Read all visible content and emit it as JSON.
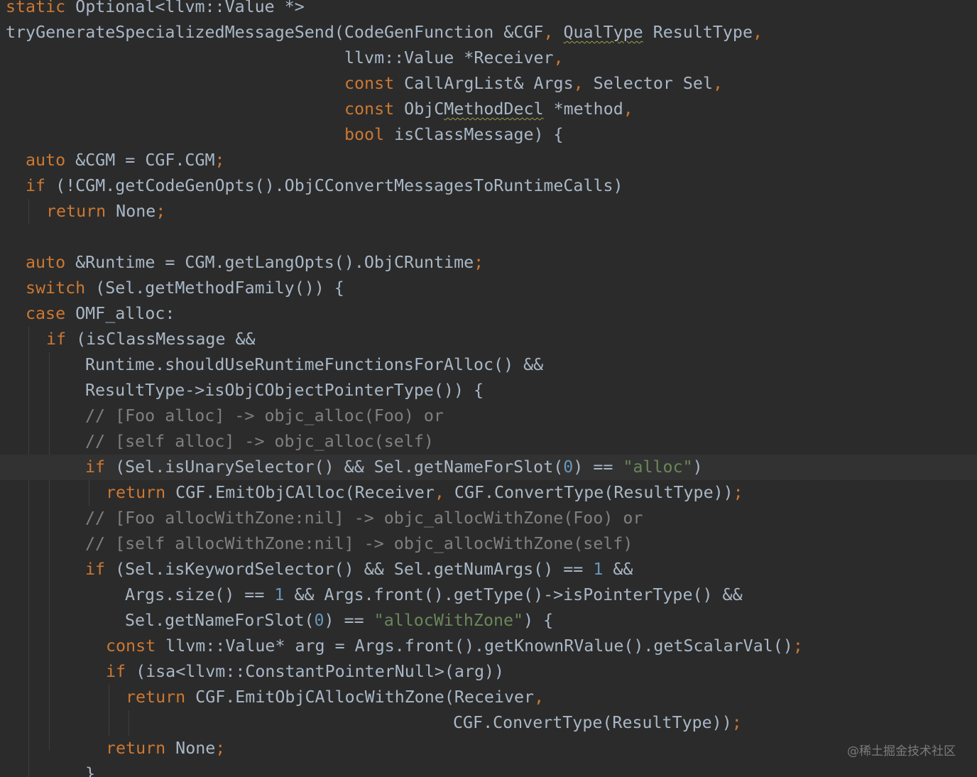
{
  "editor": {
    "lines": [
      {
        "id": 1,
        "tokens": [
          {
            "t": "static",
            "cls": "k"
          },
          {
            "t": " Optional<llvm::Value *>"
          }
        ]
      },
      {
        "id": 2,
        "tokens": [
          {
            "t": "tryGenerateSpecializedMessageSend(CodeGenFunction &CGF"
          },
          {
            "t": ",",
            "cls": "p"
          },
          {
            "t": " "
          },
          {
            "t": "QualType",
            "cls": "wavy"
          },
          {
            "t": " ResultType"
          },
          {
            "t": ",",
            "cls": "p"
          }
        ]
      },
      {
        "id": 3,
        "tokens": [
          {
            "t": "llvm::Value *Receiver"
          },
          {
            "t": ",",
            "cls": "p"
          }
        ]
      },
      {
        "id": 4,
        "tokens": [
          {
            "t": "const",
            "cls": "k"
          },
          {
            "t": " CallArgList& Args"
          },
          {
            "t": ",",
            "cls": "p"
          },
          {
            "t": " Selector Sel"
          },
          {
            "t": ",",
            "cls": "p"
          }
        ]
      },
      {
        "id": 5,
        "tokens": [
          {
            "t": "const",
            "cls": "k"
          },
          {
            "t": " ObjC"
          },
          {
            "t": "MethodDecl",
            "cls": "wavy"
          },
          {
            "t": " *method"
          },
          {
            "t": ",",
            "cls": "p"
          }
        ]
      },
      {
        "id": 6,
        "tokens": [
          {
            "t": "bool",
            "cls": "k"
          },
          {
            "t": " isClassMessage) {"
          }
        ]
      },
      {
        "id": 7,
        "tokens": [
          {
            "t": "auto",
            "cls": "k"
          },
          {
            "t": " &CGM = CGF.CGM"
          },
          {
            "t": ";",
            "cls": "p"
          }
        ]
      },
      {
        "id": 8,
        "tokens": [
          {
            "t": "if",
            "cls": "k"
          },
          {
            "t": " (!CGM.getCodeGenOpts().ObjCConvertMessagesToRuntimeCalls)"
          }
        ]
      },
      {
        "id": 9,
        "tokens": [
          {
            "t": "return",
            "cls": "k"
          },
          {
            "t": " None"
          },
          {
            "t": ";",
            "cls": "p"
          }
        ]
      },
      {
        "id": 10,
        "tokens": [
          {
            "t": "auto",
            "cls": "k"
          },
          {
            "t": " &Runtime = CGM.getLangOpts().ObjCRuntime"
          },
          {
            "t": ";",
            "cls": "p"
          }
        ]
      },
      {
        "id": 11,
        "tokens": [
          {
            "t": "switch",
            "cls": "k"
          },
          {
            "t": " (Sel.getMethodFamily()) {"
          }
        ]
      },
      {
        "id": 12,
        "tokens": [
          {
            "t": "case",
            "cls": "k"
          },
          {
            "t": " OMF_alloc:"
          }
        ]
      },
      {
        "id": 13,
        "tokens": [
          {
            "t": "if",
            "cls": "k"
          },
          {
            "t": " (isClassMessage &&"
          }
        ]
      },
      {
        "id": 14,
        "tokens": [
          {
            "t": "Runtime.shouldUseRuntimeFunctionsForAlloc() &&"
          }
        ]
      },
      {
        "id": 15,
        "tokens": [
          {
            "t": "ResultType->isObjCObjectPointerType()) {"
          }
        ]
      },
      {
        "id": 16,
        "tokens": [
          {
            "t": "// [Foo alloc] -> objc_alloc(Foo) or",
            "cls": "c"
          }
        ]
      },
      {
        "id": 17,
        "tokens": [
          {
            "t": "// [self alloc] -> objc_alloc(self)",
            "cls": "c"
          }
        ]
      },
      {
        "id": 18,
        "tokens": [
          {
            "t": "if",
            "cls": "k"
          },
          {
            "t": " (Sel.isUnarySelector() && Sel.getNameForSlot("
          },
          {
            "t": "0",
            "cls": "n"
          },
          {
            "t": ") == "
          },
          {
            "t": "\"alloc\"",
            "cls": "s"
          },
          {
            "t": ")"
          }
        ]
      },
      {
        "id": 19,
        "tokens": [
          {
            "t": "return",
            "cls": "k"
          },
          {
            "t": " CGF.EmitObjCAlloc(Receiver"
          },
          {
            "t": ",",
            "cls": "p"
          },
          {
            "t": " CGF.ConvertType(ResultType))"
          },
          {
            "t": ";",
            "cls": "p"
          }
        ]
      },
      {
        "id": 20,
        "tokens": [
          {
            "t": "// [Foo allocWithZone:nil] -> objc_allocWithZone(Foo) or",
            "cls": "c"
          }
        ]
      },
      {
        "id": 21,
        "tokens": [
          {
            "t": "// [self allocWithZone:nil] -> objc_allocWithZone(self)",
            "cls": "c"
          }
        ]
      },
      {
        "id": 22,
        "tokens": [
          {
            "t": "if",
            "cls": "k"
          },
          {
            "t": " (Sel.isKeywordSelector() && Sel.getNumArgs() == "
          },
          {
            "t": "1",
            "cls": "n"
          },
          {
            "t": " &&"
          }
        ]
      },
      {
        "id": 23,
        "tokens": [
          {
            "t": "Args.size() == "
          },
          {
            "t": "1",
            "cls": "n"
          },
          {
            "t": " && Args.front().getType()->isPointerType() &&"
          }
        ]
      },
      {
        "id": 24,
        "tokens": [
          {
            "t": "Sel.getNameForSlot("
          },
          {
            "t": "0",
            "cls": "n"
          },
          {
            "t": ") == "
          },
          {
            "t": "\"allocWithZone\"",
            "cls": "s"
          },
          {
            "t": ") {"
          }
        ]
      },
      {
        "id": 25,
        "tokens": [
          {
            "t": "const",
            "cls": "k"
          },
          {
            "t": " llvm::Value* arg = Args.front().getKnownRValue().getScalarVal()"
          },
          {
            "t": ";",
            "cls": "p"
          }
        ]
      },
      {
        "id": 26,
        "tokens": [
          {
            "t": "if",
            "cls": "k"
          },
          {
            "t": " (isa<llvm::ConstantPointerNull>(arg))"
          }
        ]
      },
      {
        "id": 27,
        "tokens": [
          {
            "t": "return",
            "cls": "k"
          },
          {
            "t": " CGF.EmitObjCAllocWithZone(Receiver"
          },
          {
            "t": ",",
            "cls": "p"
          }
        ]
      },
      {
        "id": 28,
        "tokens": [
          {
            "t": "CGF.ConvertType(ResultType))"
          },
          {
            "t": ";",
            "cls": "p"
          }
        ]
      },
      {
        "id": 29,
        "tokens": [
          {
            "t": "return",
            "cls": "k"
          },
          {
            "t": " None"
          },
          {
            "t": ";",
            "cls": "p"
          }
        ]
      },
      {
        "id": 30,
        "tokens": [
          {
            "t": "}"
          }
        ]
      }
    ]
  },
  "watermark": "@稀土掘金技术社区"
}
